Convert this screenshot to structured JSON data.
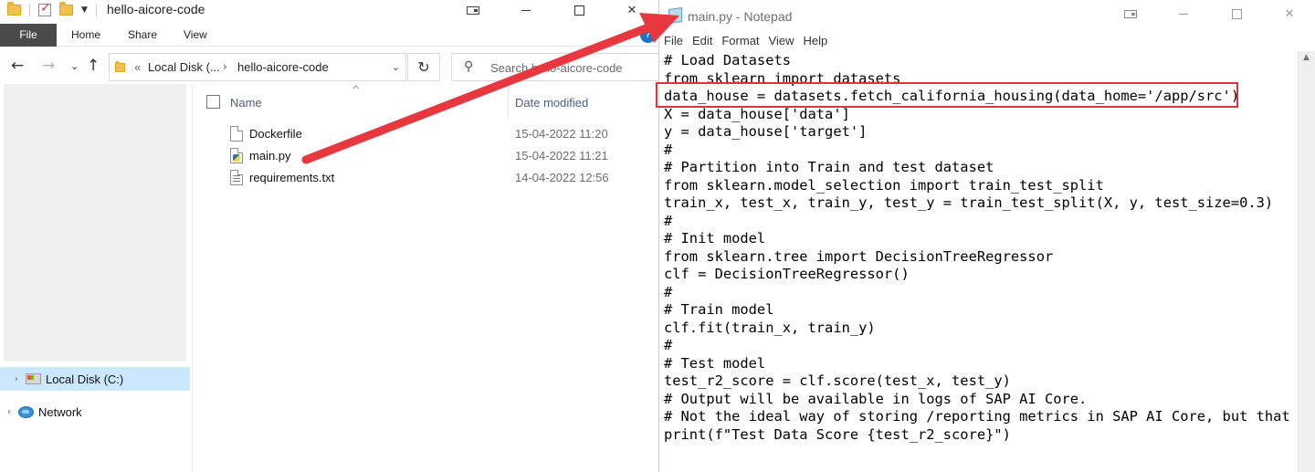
{
  "explorer": {
    "title": "hello-aicore-code",
    "ribbon_tabs": [
      "File",
      "Home",
      "Share",
      "View"
    ],
    "breadcrumbs": [
      "«",
      "Local Disk (...",
      "hello-aicore-code"
    ],
    "search_placeholder": "Search hello-aicore-code",
    "columns": {
      "name": "Name",
      "date": "Date modified"
    },
    "files": [
      {
        "name": "Dockerfile",
        "date": "15-04-2022 11:20",
        "icon": "file-icon"
      },
      {
        "name": "main.py",
        "date": "15-04-2022 11:21",
        "icon": "python-file-icon"
      },
      {
        "name": "requirements.txt",
        "date": "14-04-2022 12:56",
        "icon": "text-file-icon"
      }
    ],
    "nav": [
      {
        "label": "Local Disk (C:)",
        "icon": "drive-icon",
        "selected": true
      },
      {
        "label": "Network",
        "icon": "network-icon",
        "selected": false
      }
    ]
  },
  "notepad": {
    "title": "main.py - Notepad",
    "menu": [
      "File",
      "Edit",
      "Format",
      "View",
      "Help"
    ],
    "lines": [
      "# Load Datasets",
      "from sklearn import datasets",
      "data_house = datasets.fetch_california_housing(data_home='/app/src')",
      "X = data_house['data']",
      "y = data_house['target']",
      "#",
      "# Partition into Train and test dataset",
      "from sklearn.model_selection import train_test_split",
      "train_x, test_x, train_y, test_y = train_test_split(X, y, test_size=0.3)",
      "#",
      "# Init model",
      "from sklearn.tree import DecisionTreeRegressor",
      "clf = DecisionTreeRegressor()",
      "#",
      "# Train model",
      "clf.fit(train_x, train_y)",
      "#",
      "# Test model",
      "test_r2_score = clf.score(test_x, test_y)",
      "# Output will be available in logs of SAP AI Core.",
      "# Not the ideal way of storing /reporting metrics in SAP AI Core, but that is",
      "print(f\"Test Data Score {test_r2_score}\")"
    ]
  },
  "annotation": {
    "color": "#e8373f"
  }
}
